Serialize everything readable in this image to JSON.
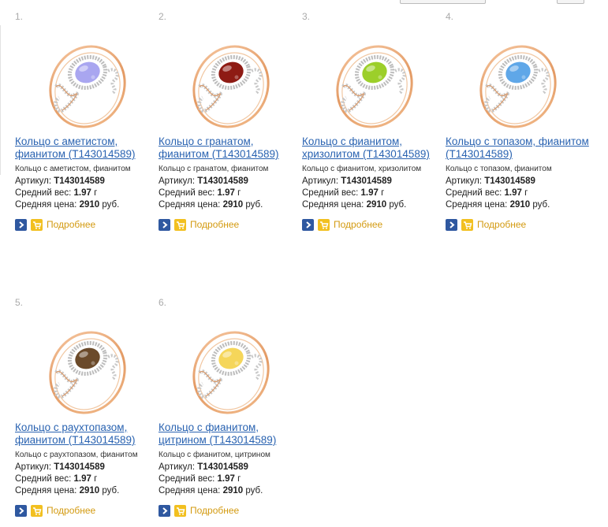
{
  "labels": {
    "article": "Артикул:",
    "weight": "Средний вес:",
    "price": "Средняя цена:",
    "weight_unit": " г",
    "price_unit": " руб.",
    "more": "Подробнее"
  },
  "products": [
    {
      "number": "1.",
      "title": "Кольцо с аметистом, фианитом (Т143014589)",
      "desc": "Кольцо с аметистом, фианитом",
      "article": "Т143014589",
      "weight": "1.97",
      "price": "2910",
      "stone_color": "#a9a6f0"
    },
    {
      "number": "2.",
      "title": "Кольцо с гранатом, фианитом (Т143014589)",
      "desc": "Кольцо с гранатом, фианитом",
      "article": "Т143014589",
      "weight": "1.97",
      "price": "2910",
      "stone_color": "#8e1b14"
    },
    {
      "number": "3.",
      "title": "Кольцо с фианитом, хризолитом (Т143014589)",
      "desc": "Кольцо с фианитом, хризолитом",
      "article": "Т143014589",
      "weight": "1.97",
      "price": "2910",
      "stone_color": "#9ccf2a"
    },
    {
      "number": "4.",
      "title": "Кольцо с топазом, фианитом (Т143014589)",
      "desc": "Кольцо с топазом, фианитом",
      "article": "Т143014589",
      "weight": "1.97",
      "price": "2910",
      "stone_color": "#5fa7e8"
    },
    {
      "number": "5.",
      "title": "Кольцо с раухтопазом, фианитом (Т143014589)",
      "desc": "Кольцо с раухтопазом, фианитом",
      "article": "Т143014589",
      "weight": "1.97",
      "price": "2910",
      "stone_color": "#6b4a2a"
    },
    {
      "number": "6.",
      "title": "Кольцо с фианитом, цитрином (Т143014589)",
      "desc": "Кольцо с фианитом, цитрином",
      "article": "Т143014589",
      "weight": "1.97",
      "price": "2910",
      "stone_color": "#f5d65a"
    }
  ],
  "icons": {
    "go": "arrow-right-icon",
    "cart": "cart-icon"
  },
  "colors": {
    "link": "#2a63b1",
    "more": "#d39a10",
    "go_button": "#2f58a0",
    "cart_button": "#f2c020"
  }
}
